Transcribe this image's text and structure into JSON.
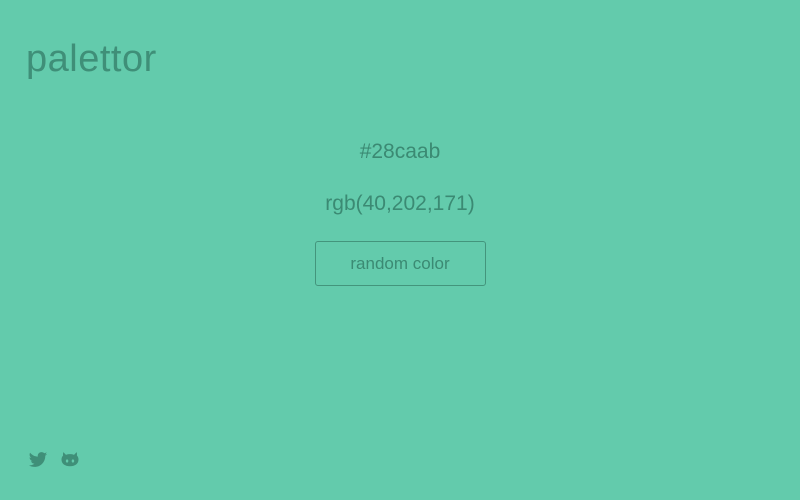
{
  "app": {
    "title": "palettor"
  },
  "color": {
    "hex": "#28caab",
    "rgb": "rgb(40,202,171)"
  },
  "actions": {
    "random_label": "random color"
  },
  "social": {
    "twitter_icon": "twitter-icon",
    "github_icon": "github-icon"
  },
  "theme": {
    "background": "#63cbac",
    "text": "#3b8a73"
  }
}
